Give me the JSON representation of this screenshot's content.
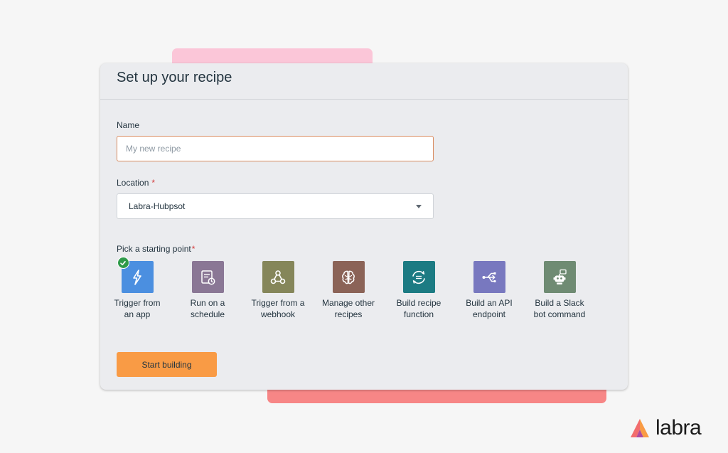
{
  "form": {
    "title": "Set up your recipe",
    "name": {
      "label": "Name",
      "placeholder": "My new recipe",
      "value": ""
    },
    "location": {
      "label": "Location",
      "required_mark": "*",
      "value": "Labra-Hubpsot"
    },
    "starting_point": {
      "label": "Pick a starting point",
      "required_mark": "*",
      "selected": "trigger-from-app",
      "options": [
        {
          "id": "trigger-from-app",
          "label": "Trigger from an app",
          "icon": "lightning-bolt-icon",
          "color": "#4b8fe0"
        },
        {
          "id": "run-on-schedule",
          "label": "Run on a schedule",
          "icon": "calendar-clock-icon",
          "color": "#8a7795"
        },
        {
          "id": "trigger-from-webhook",
          "label": "Trigger from a webhook",
          "icon": "webhook-icon",
          "color": "#85865a"
        },
        {
          "id": "manage-other-recipes",
          "label": "Manage other recipes",
          "icon": "brain-icon",
          "color": "#8b6357"
        },
        {
          "id": "build-recipe-function",
          "label": "Build recipe function",
          "icon": "function-cycle-icon",
          "color": "#1c7b83"
        },
        {
          "id": "build-api-endpoint",
          "label": "Build an API endpoint",
          "icon": "api-branch-icon",
          "color": "#7878bf"
        },
        {
          "id": "build-slack-bot-command",
          "label": "Build a Slack bot command",
          "icon": "robot-icon",
          "color": "#6f8b73"
        }
      ]
    },
    "submit_label": "Start building"
  },
  "brand": {
    "name": "labra",
    "icon": "labra-logo-icon"
  },
  "colors": {
    "accent_button": "#f99b45",
    "selected_check": "#2f9a4a",
    "required": "#d33a3a"
  }
}
